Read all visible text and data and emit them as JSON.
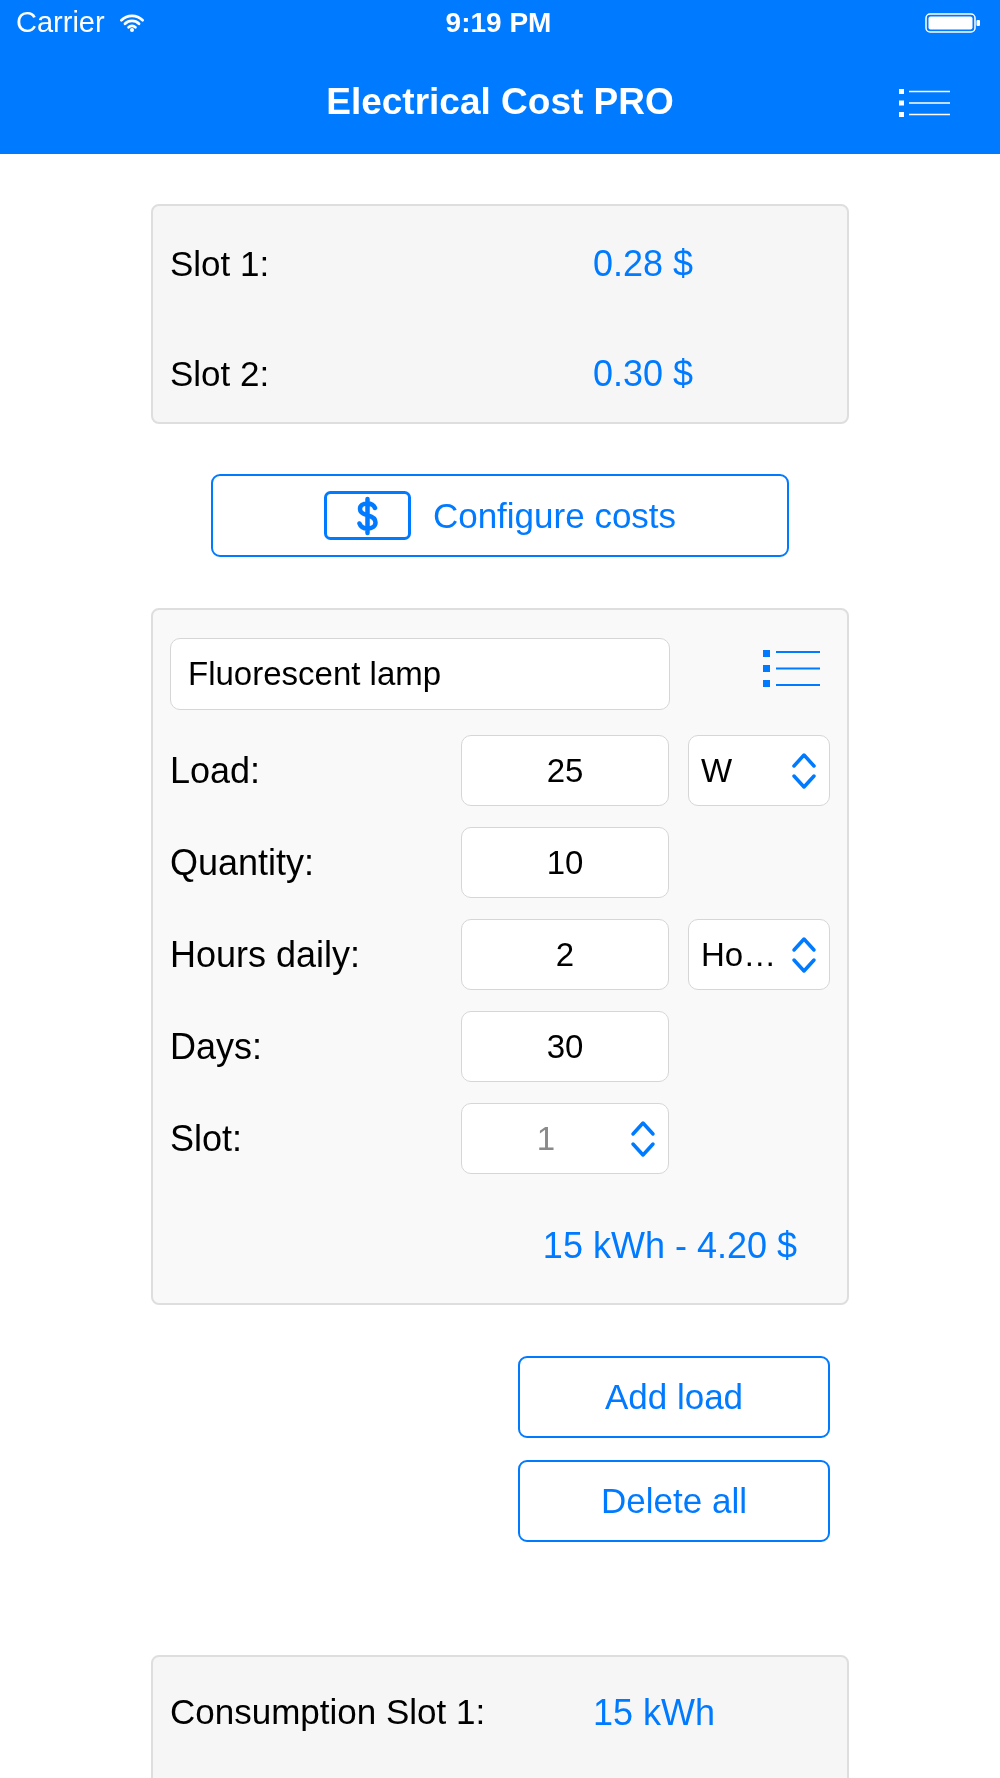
{
  "status_bar": {
    "carrier": "Carrier",
    "time": "9:19 PM"
  },
  "nav_bar": {
    "title": "Electrical Cost PRO"
  },
  "slot_costs": [
    {
      "label": "Slot 1:",
      "value": "0.28 $"
    },
    {
      "label": "Slot 2:",
      "value": "0.30 $"
    }
  ],
  "configure_button": {
    "label": "Configure costs"
  },
  "load": {
    "name": "Fluorescent lamp",
    "rows": [
      {
        "kind": "unit",
        "label": "Load:",
        "value": "25",
        "unit": "W"
      },
      {
        "kind": "plain",
        "label": "Quantity:",
        "value": "10"
      },
      {
        "kind": "unit",
        "label": "Hours daily:",
        "value": "2",
        "unit": "Ho…"
      },
      {
        "kind": "plain",
        "label": "Days:",
        "value": "30"
      },
      {
        "kind": "picker",
        "label": "Slot:",
        "value": "1"
      }
    ],
    "result": "15 kWh - 4.20 $"
  },
  "actions": [
    "Add load",
    "Delete all"
  ],
  "consumption": [
    {
      "label": "Consumption Slot 1:",
      "value": "15 kWh"
    }
  ]
}
